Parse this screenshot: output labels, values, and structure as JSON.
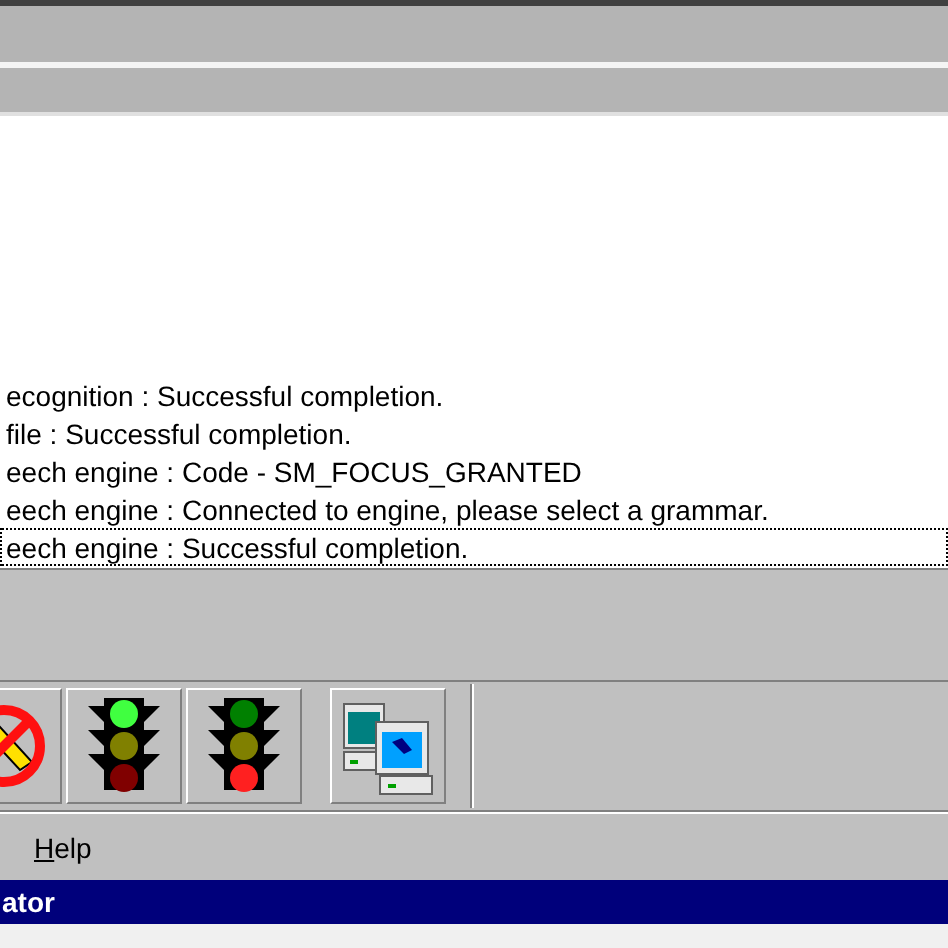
{
  "window": {
    "title": "ator"
  },
  "menu": [
    {
      "label": "Help",
      "selected": false
    }
  ],
  "toolbar": [
    {
      "kind": "no-entry"
    },
    {
      "kind": "traffic-light",
      "lamps": [
        {
          "color": "#40ff40"
        },
        {
          "color": "#808000"
        },
        {
          "color": "#800000"
        }
      ]
    },
    {
      "kind": "traffic-light",
      "lamps": [
        {
          "color": "#008000"
        },
        {
          "color": "#808000"
        },
        {
          "color": "#ff2020"
        }
      ]
    },
    {
      "kind": "network"
    }
  ],
  "log": [
    {
      "text": "ecognition : Successful completion.",
      "focused": false
    },
    {
      "text": "file : Successful completion.",
      "focused": false
    },
    {
      "text": "eech engine : Code - SM_FOCUS_GRANTED",
      "focused": false
    },
    {
      "text": "eech engine : Connected to engine, please select a grammar.",
      "focused": false
    },
    {
      "text": "eech engine : Successful completion.",
      "focused": true
    }
  ]
}
